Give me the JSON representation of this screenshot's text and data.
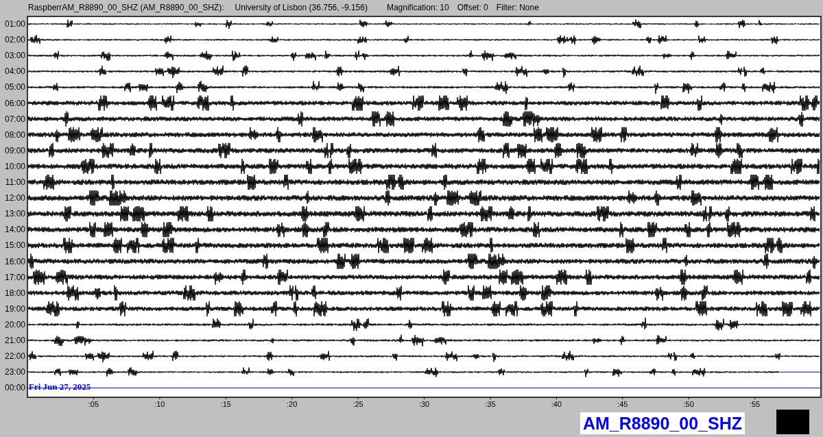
{
  "header": {
    "station": "RaspberrAM_R8890_00_SHZ (AM_R8890_00_SHZ):",
    "location": "University of Lisbon (36.756, -9.156)",
    "magnification": "Magnification: 10",
    "offset": "Offset: 0",
    "filter": "Filter: None"
  },
  "helicorder": {
    "rows": [
      {
        "label": "01:00",
        "kind": "full"
      },
      {
        "label": "02:00",
        "kind": "full"
      },
      {
        "label": "03:00",
        "kind": "full"
      },
      {
        "label": "04:00",
        "kind": "full"
      },
      {
        "label": "05:00",
        "kind": "full"
      },
      {
        "label": "06:00",
        "kind": "full"
      },
      {
        "label": "07:00",
        "kind": "full"
      },
      {
        "label": "08:00",
        "kind": "full"
      },
      {
        "label": "09:00",
        "kind": "full"
      },
      {
        "label": "10:00",
        "kind": "full"
      },
      {
        "label": "11:00",
        "kind": "full"
      },
      {
        "label": "12:00",
        "kind": "full"
      },
      {
        "label": "13:00",
        "kind": "full"
      },
      {
        "label": "14:00",
        "kind": "full"
      },
      {
        "label": "15:00",
        "kind": "full"
      },
      {
        "label": "16:00",
        "kind": "full"
      },
      {
        "label": "17:00",
        "kind": "full"
      },
      {
        "label": "18:00",
        "kind": "full"
      },
      {
        "label": "19:00",
        "kind": "full"
      },
      {
        "label": "20:00",
        "kind": "full"
      },
      {
        "label": "21:00",
        "kind": "full"
      },
      {
        "label": "22:00",
        "kind": "full"
      },
      {
        "label": "23:00",
        "kind": "partial"
      },
      {
        "label": "00:00",
        "kind": "pending"
      }
    ],
    "date": "Fri Jun 27, 2025",
    "x_ticks": [
      ":05",
      ":10",
      ":15",
      ":20",
      ":25",
      ":30",
      ":35",
      ":40",
      ":45",
      ":50",
      ":55"
    ]
  },
  "station_label": "AM_R8890_00_SHZ"
}
